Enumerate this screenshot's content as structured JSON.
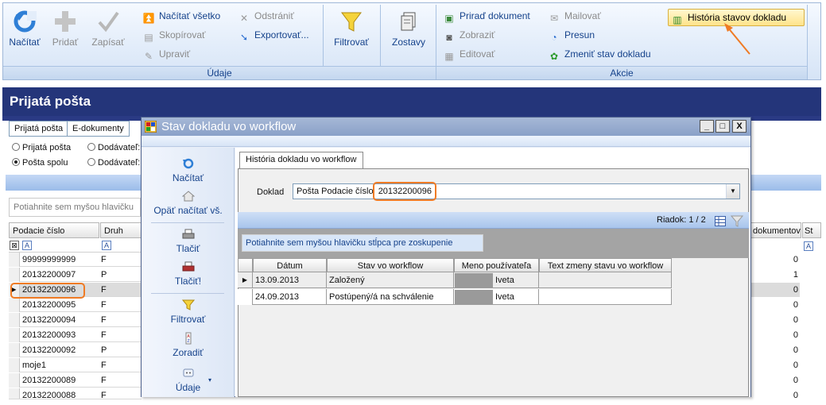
{
  "ribbon": {
    "udaje_group": {
      "label": "Údaje",
      "nacitat": "Načítať",
      "pridat": "Pridať",
      "zapisat": "Zapísať",
      "nacitat_vsetko": "Načítať všetko",
      "odstranit": "Odstrániť",
      "skopirovat": "Skopírovať",
      "exportovat": "Exportovať...",
      "upravit": "Upraviť",
      "filtrovat": "Filtrovať",
      "zostavy": "Zostavy"
    },
    "akcie_group": {
      "label": "Akcie",
      "priradit_dokument": "Priraď dokument",
      "mailovat": "Mailovať",
      "zobrazit": "Zobraziť",
      "presun": "Presun",
      "editovat": "Editovať",
      "zmenit_stav": "Zmeniť stav dokladu",
      "historia": "História stavov dokladu"
    }
  },
  "main": {
    "title": "Prijatá pošta",
    "tabs": [
      "Prijatá pošta",
      "E-dokumenty"
    ],
    "radios": [
      {
        "label": "Prijatá pošta",
        "checked": false
      },
      {
        "label": "Dodávateľ:",
        "checked": false
      },
      {
        "label": "Pošta spolu",
        "checked": true
      },
      {
        "label": "Dodávateľ:",
        "checked": false
      }
    ],
    "group_hint": "Potiahnite sem myšou hlavičku",
    "columns": {
      "podacie": "Podacie číslo",
      "druh": "Druh",
      "dokumentov": "dokumentov",
      "st": "St"
    },
    "filter_glyph": "A",
    "rows": [
      {
        "podacie": "99999999999",
        "druh": "F",
        "count": "0"
      },
      {
        "podacie": "20132200097",
        "druh": "P",
        "count": "1"
      },
      {
        "podacie": "20132200096",
        "druh": "F",
        "count": "0"
      },
      {
        "podacie": "20132200095",
        "druh": "F",
        "count": "0"
      },
      {
        "podacie": "20132200094",
        "druh": "F",
        "count": "0"
      },
      {
        "podacie": "20132200093",
        "druh": "F",
        "count": "0"
      },
      {
        "podacie": "20132200092",
        "druh": "P",
        "count": "0"
      },
      {
        "podacie": "moje1",
        "druh": "F",
        "count": "0"
      },
      {
        "podacie": "20132200089",
        "druh": "F",
        "count": "0"
      },
      {
        "podacie": "20132200088",
        "druh": "F",
        "count": "0"
      }
    ]
  },
  "dialog": {
    "title": "Stav dokladu vo workflow",
    "window_buttons": {
      "minimize": "_",
      "maximize": "□",
      "close": "X"
    },
    "side": {
      "nacitat": "Načítať",
      "opat_nacitat": "Opäť načítať vš.",
      "tlacit": "Tlačiť",
      "tlacit_excl": "Tlačiť!",
      "filtrovat": "Filtrovať",
      "zoradit": "Zoradiť",
      "udaje": "Údaje"
    },
    "tab": "História dokladu vo workflow",
    "doklad_label": "Doklad",
    "doklad_prefix": "Pošta Podacie číslo",
    "doklad_number": "20132200096",
    "riadok": "Riadok: 1 / 2",
    "group_hint": "Potiahnite sem myšou hlavičku stĺpca pre zoskupenie",
    "columns": [
      "Dátum",
      "Stav vo workflow",
      "Meno používateľa",
      "Text zmeny stavu vo workflow"
    ],
    "rows": [
      {
        "datum": "13.09.2013",
        "stav": "Založený",
        "meno": "Iveta",
        "text": ""
      },
      {
        "datum": "24.09.2013",
        "stav": "Postúpený/á na schválenie",
        "meno": "Iveta",
        "text": ""
      }
    ]
  }
}
